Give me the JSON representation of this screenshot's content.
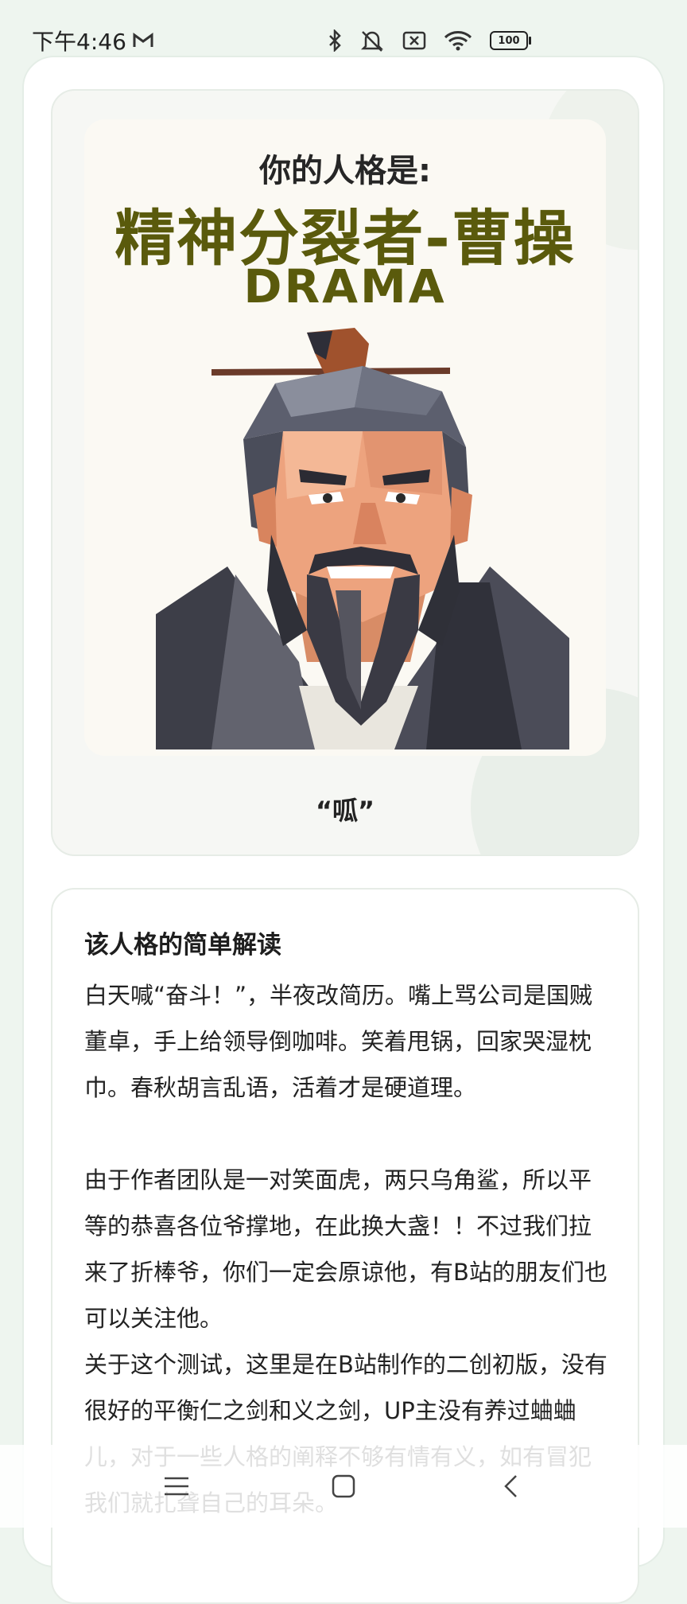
{
  "status_bar": {
    "time": "下午4:46",
    "battery": "100"
  },
  "result": {
    "prefix": "你的人格是:",
    "title": "精神分裂者-曹操",
    "code": "DRAMA",
    "quote": "“呱”"
  },
  "explanation": {
    "heading": "该人格的简单解读",
    "body": "白天喊“奋斗！”，半夜改简历。嘴上骂公司是国贼董卓，手上给领导倒咖啡。笑着甩锅，回家哭湿枕巾。春秋胡言乱语，活着才是硬道理。\n\n由于作者团队是一对笑面虎，两只乌角鲨，所以平等的恭喜各位爷撑地，在此换大盏！！不过我们拉来了折棒爷，你们一定会原谅他，有B站的朋友们也可以关注他。\n关于这个测试，这里是在B站制作的二创初版，没有很好的平衡仁之剑和义之剑，UP主没有养过蛐蛐儿，对于一些人格的阐释不够有情有义，如有冒犯我们就扎聋自己的耳朵。"
  },
  "icons": {
    "mail": "gmail-icon",
    "bluetooth": "bluetooth-icon",
    "mute": "mute-icon",
    "sim": "no-sim-icon",
    "wifi": "wifi-icon",
    "menu": "menu-icon",
    "home": "home-icon",
    "back": "back-icon"
  },
  "colors": {
    "title": "#5a5a0c",
    "background": "#eef5ef"
  }
}
